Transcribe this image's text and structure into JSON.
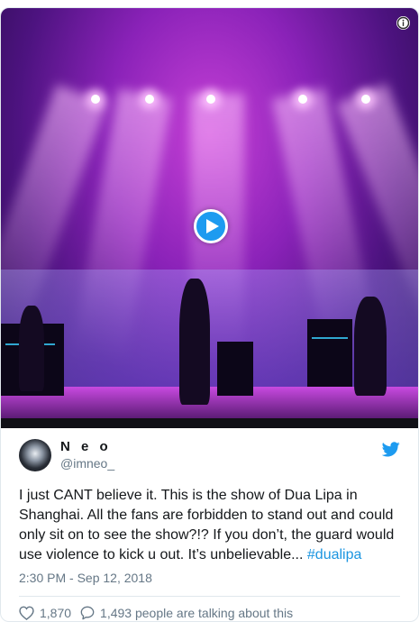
{
  "media": {
    "play_icon": "play-icon",
    "info_icon": "info-icon"
  },
  "author": {
    "display_name": "N e o",
    "handle": "@imneo_",
    "avatar_icon": "avatar",
    "brand_icon": "twitter-bird-icon"
  },
  "tweet": {
    "text": "I just CANT believe it. This is the show of Dua Lipa in Shanghai. All the fans are forbidden to stand out and could only sit on to see the show?!? If you don’t, the guard would use violence to kick u out. It’s unbelievable... ",
    "hashtag": "#dualipa",
    "timestamp": "2:30 PM - Sep 12, 2018"
  },
  "engagement": {
    "likes": "1,870",
    "talking": "1,493 people are talking about this",
    "like_icon": "heart-icon",
    "reply_icon": "speech-bubble-icon"
  },
  "colors": {
    "brand": "#1d9bf0",
    "link": "#1b95e0",
    "muted": "#657786"
  }
}
